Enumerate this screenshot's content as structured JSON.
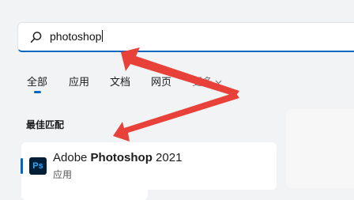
{
  "search": {
    "value": "photoshop"
  },
  "tabs": [
    {
      "label": "全部",
      "selected": true
    },
    {
      "label": "应用"
    },
    {
      "label": "文档"
    },
    {
      "label": "网页"
    },
    {
      "label": "更多"
    }
  ],
  "best_match": {
    "heading": "最佳匹配",
    "result": {
      "icon_text": "Ps",
      "title_prefix": "Adobe ",
      "title_bold": "Photoshop",
      "title_suffix": " 2021",
      "subtitle": "应用"
    }
  },
  "colors": {
    "accent": "#0067c0",
    "annotation_arrow": "#e8413a",
    "ps_icon_bg": "#001e36",
    "ps_icon_fg": "#31a8ff"
  }
}
